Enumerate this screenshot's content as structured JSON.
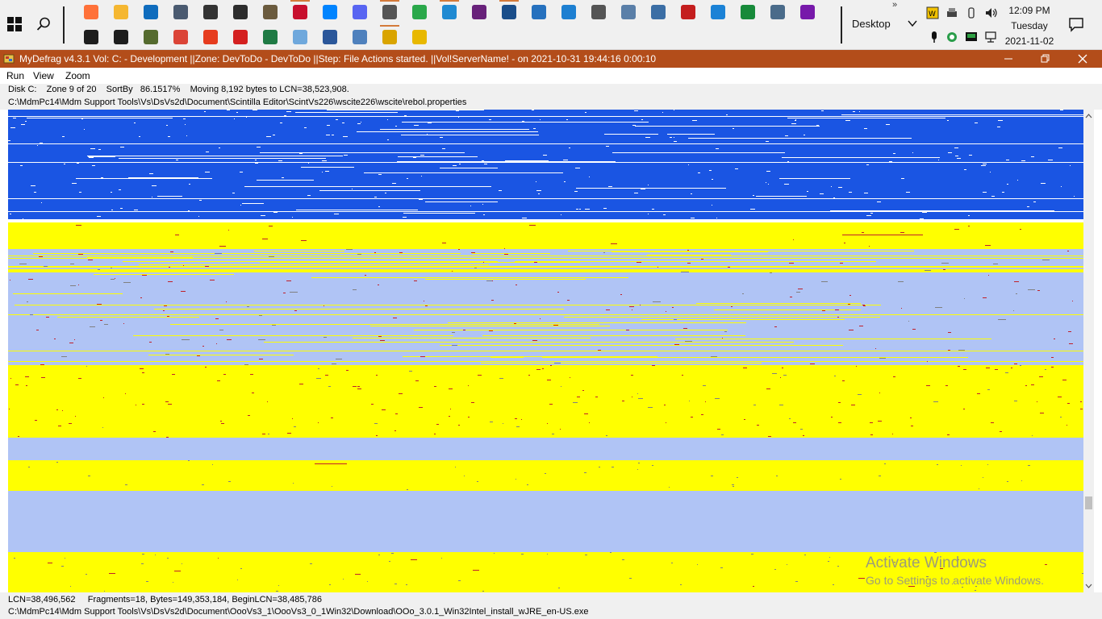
{
  "taskbar": {
    "desktop_label": "Desktop",
    "more_chevron": "»",
    "clock": {
      "time": "12:09 PM",
      "day": "Tuesday",
      "date": "2021-11-02"
    },
    "pinned_row1": [
      {
        "name": "firefox-icon",
        "color": "#ff7139",
        "active": false
      },
      {
        "name": "file-explorer-icon",
        "color": "#f5b731",
        "active": false
      },
      {
        "name": "outlook-icon",
        "color": "#0f6cbd",
        "active": false
      },
      {
        "name": "tool-icon",
        "color": "#4a5a70",
        "active": false
      },
      {
        "name": "printer-icon",
        "color": "#333333",
        "active": false
      },
      {
        "name": "camera-icon",
        "color": "#2d2d2d",
        "active": false
      },
      {
        "name": "gimp-icon",
        "color": "#6b5b3e",
        "active": false
      },
      {
        "name": "notebook-icon",
        "color": "#c8102e",
        "active": true
      },
      {
        "name": "messenger-icon",
        "color": "#0084ff",
        "active": false
      },
      {
        "name": "discord-icon",
        "color": "#5865f2",
        "active": false
      },
      {
        "name": "clock-app-icon",
        "color": "#555555",
        "active": true
      },
      {
        "name": "paint-icon",
        "color": "#2aa84a",
        "active": false
      },
      {
        "name": "vscode-icon",
        "color": "#1f8ad2",
        "active": true
      },
      {
        "name": "visual-studio-icon",
        "color": "#68217a",
        "active": false
      },
      {
        "name": "diagram-app-icon",
        "color": "#1a4e8a",
        "active": true
      },
      {
        "name": "powershell-icon",
        "color": "#2671be",
        "active": false
      },
      {
        "name": "grid-app-icon",
        "color": "#1d7fd1",
        "active": false
      },
      {
        "name": "settings-icon",
        "color": "#555555",
        "active": false
      },
      {
        "name": "device-manager-icon",
        "color": "#5a7fa8",
        "active": false
      },
      {
        "name": "system-info-icon",
        "color": "#3b6ea5",
        "active": false
      },
      {
        "name": "pdf-tool-icon",
        "color": "#c41e1e",
        "active": false
      },
      {
        "name": "todo-icon",
        "color": "#1b82d6",
        "active": false
      },
      {
        "name": "money-app-icon",
        "color": "#178a3a",
        "active": false
      },
      {
        "name": "remote-desktop-icon",
        "color": "#4a6b8a",
        "active": false
      },
      {
        "name": "onenote-icon",
        "color": "#7719aa",
        "active": false
      }
    ],
    "pinned_row2": [
      {
        "name": "command-prompt-icon",
        "color": "#1e1e1e",
        "active": false
      },
      {
        "name": "command-prompt-admin-icon",
        "color": "#1e1e1e",
        "active": false
      },
      {
        "name": "tree-app-icon",
        "color": "#556b2f",
        "active": false
      },
      {
        "name": "chrome-icon",
        "color": "#db4437",
        "active": false
      },
      {
        "name": "office-icon",
        "color": "#e63c1e",
        "active": false
      },
      {
        "name": "acrobat-icon",
        "color": "#d42020",
        "active": false
      },
      {
        "name": "excel-icon",
        "color": "#1f7a44",
        "active": false
      },
      {
        "name": "notepad-icon",
        "color": "#6fa8dc",
        "active": false
      },
      {
        "name": "word-icon",
        "color": "#2b579a",
        "active": false
      },
      {
        "name": "document-icon",
        "color": "#4f81bd",
        "active": false
      },
      {
        "name": "mydefrag-icon",
        "color": "#d9a400",
        "active": true
      },
      {
        "name": "help-icon",
        "color": "#e8b800",
        "active": false
      }
    ]
  },
  "window": {
    "title": "MyDefrag v4.3.1    Vol: C: - Development ||Zone: DevToDo - DevToDo ||Step: File Actions started. ||Vol!ServerName! -  on 2021-10-31 19:44:16 0:00:10",
    "titlebar_color": "#b34d1a"
  },
  "menu": {
    "items": [
      "Run",
      "View",
      "Zoom"
    ]
  },
  "status": {
    "line1": "Disk C:    Zone 9 of 20    SortBy   86.1517%    Moving 8,192 bytes to LCN=38,523,908.",
    "line2": "C:\\MdmPc14\\Mdm Support Tools\\Vs\\DsVs2d\\Document\\Scintilla Editor\\ScintVs226\\wscite226\\wscite\\rebol.properties"
  },
  "bottom": {
    "line1": "LCN=38,496,562     Fragments=18, Bytes=149,353,184, BeginLCN=38,485,786",
    "line2": "C:\\MdmPc14\\Mdm Support Tools\\Vs\\DsVs2d\\Document\\OooVs3_1\\OooVs3_0_1Win32\\Download\\OOo_3.0.1_Win32Intel_install_wJRE_en-US.exe"
  },
  "watermark": {
    "line1": "Activate Windows",
    "line2": "Go to Settings to activate Windows."
  },
  "diskmap_colors": {
    "blue": "#1a55e3",
    "yellow": "#ffff00",
    "light_blue": "#b0c4f5",
    "white": "#ffffff",
    "red": "#c0202a",
    "gray": "#808080"
  }
}
